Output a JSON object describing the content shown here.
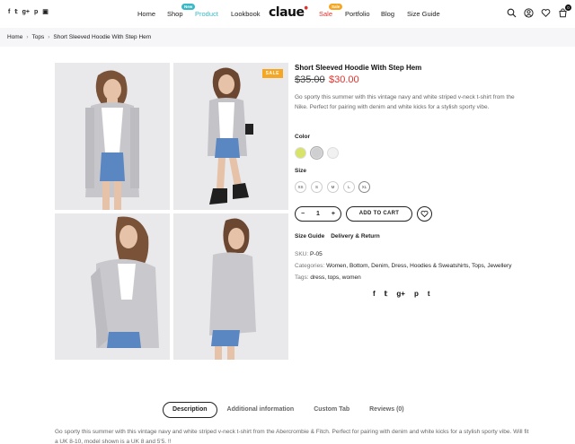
{
  "header": {
    "social": [
      "f",
      "𝕥",
      "g+",
      "p",
      "▣"
    ],
    "nav": {
      "home": "Home",
      "shop": "Shop",
      "shop_badge": "New",
      "product": "Product",
      "lookbook": "Lookbook",
      "sale": "Sale",
      "sale_badge": "Sale",
      "portfolio": "Portfolio",
      "blog": "Blog",
      "size_guide": "Size Guide"
    },
    "logo": "claue",
    "cart_count": "0"
  },
  "breadcrumb": {
    "home": "Home",
    "tops": "Tops",
    "current": "Short Sleeved Hoodie With Step Hem"
  },
  "gallery": {
    "sale_tag": "SALE"
  },
  "product": {
    "title": "Short Sleeved Hoodie With Step Hem",
    "price_old": "$35.00",
    "price_new": "$30.00",
    "description": "Go sporty this summer with this vintage navy and white striped v-neck t-shirt from the Nike. Perfect for pairing with denim and white kicks for a stylish sporty vibe.",
    "color_label": "Color",
    "colors": [
      "#d8e36a",
      "#cfcfd2",
      "#f1f1f1"
    ],
    "size_label": "Size",
    "sizes": [
      "XS",
      "S",
      "M",
      "L",
      "XL"
    ],
    "quantity": "1",
    "add_to_cart": "ADD TO CART",
    "size_guide": "Size Guide",
    "delivery_return": "Delivery & Return",
    "sku_label": "SKU:",
    "sku_value": "P-05",
    "categories_label": "Categories:",
    "categories_value": "Women, Bottom, Denim, Dress, Hoodies & Sweatshirts, Tops, Jewellery",
    "tags_label": "Tags:",
    "tags_value": "dress, tops, women",
    "share": [
      "f",
      "𝕥",
      "g+",
      "p",
      "t"
    ]
  },
  "tabs": {
    "description": "Description",
    "additional": "Additional information",
    "custom": "Custom Tab",
    "reviews": "Reviews (0)"
  },
  "long_description": "Go sporty this summer with this vintage navy and white striped v-neck t-shirt from the Abercrombie & Fitch. Perfect for pairing with denim and white kicks for a stylish sporty vibe. Will fit a UK 8-10, model shown is a UK 8 and 5'5. !!"
}
